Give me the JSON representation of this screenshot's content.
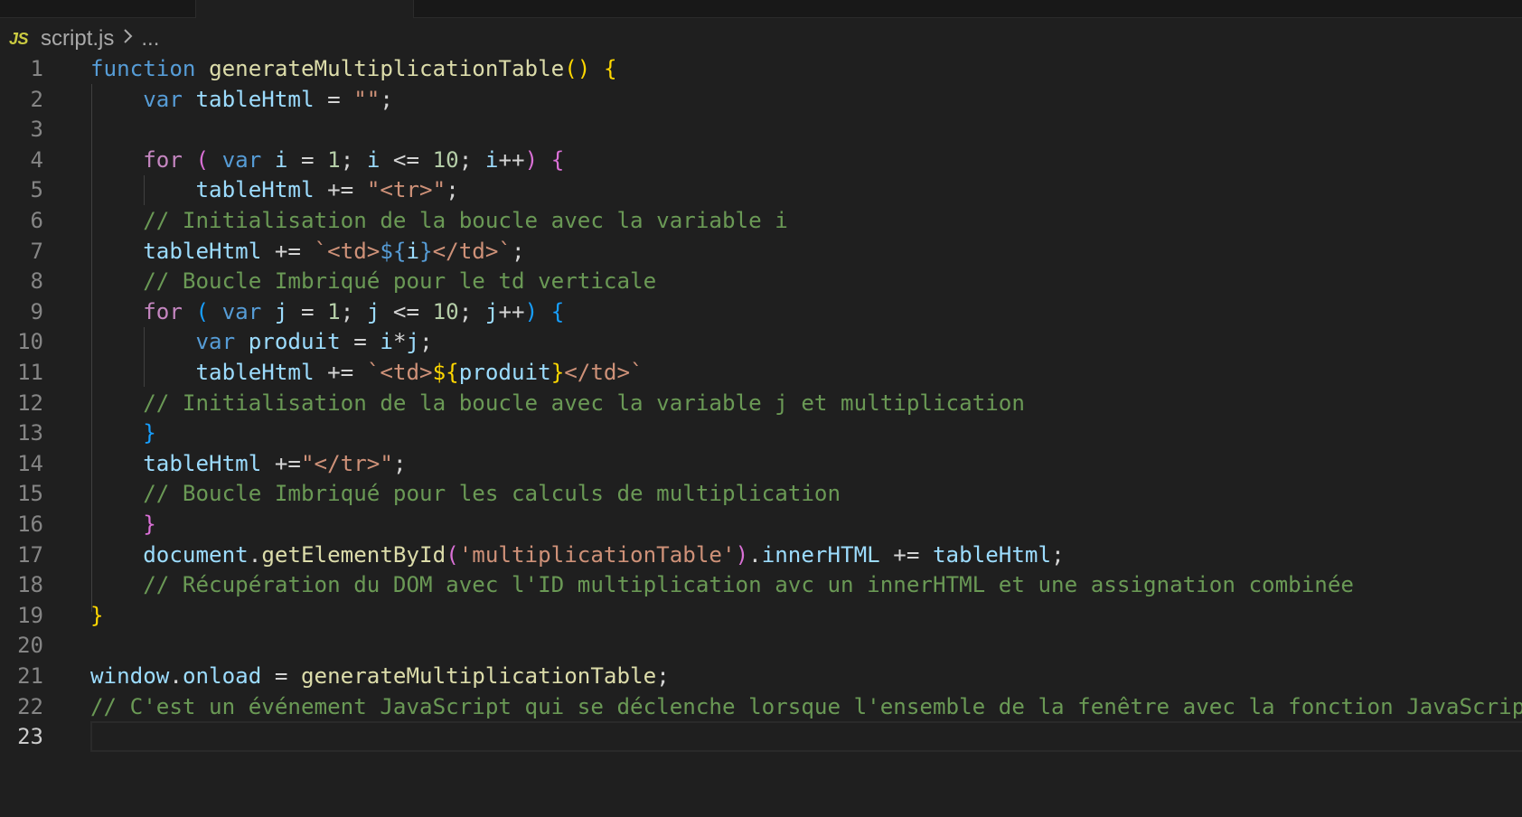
{
  "breadcrumb": {
    "file_icon": "JS",
    "file_name": "script.js",
    "separator_icon": "chevron-right-icon",
    "more": "..."
  },
  "editor": {
    "current_line": 23,
    "lines": [
      {
        "number": "1",
        "tokens": [
          [
            "kw",
            "function"
          ],
          [
            "plain",
            " "
          ],
          [
            "fn",
            "generateMultiplicationTable"
          ],
          [
            "brk1",
            "()"
          ],
          [
            "plain",
            " "
          ],
          [
            "brk1",
            "{"
          ]
        ]
      },
      {
        "number": "2",
        "tokens": [
          [
            "plain",
            "    "
          ],
          [
            "kw",
            "var"
          ],
          [
            "plain",
            " "
          ],
          [
            "var",
            "tableHtml"
          ],
          [
            "plain",
            " = "
          ],
          [
            "str",
            "\"\""
          ],
          [
            "plain",
            ";"
          ]
        ]
      },
      {
        "number": "3",
        "tokens": []
      },
      {
        "number": "4",
        "tokens": [
          [
            "plain",
            "    "
          ],
          [
            "ctl",
            "for"
          ],
          [
            "plain",
            " "
          ],
          [
            "brk2",
            "("
          ],
          [
            "plain",
            " "
          ],
          [
            "kw",
            "var"
          ],
          [
            "plain",
            " "
          ],
          [
            "var",
            "i"
          ],
          [
            "plain",
            " = "
          ],
          [
            "num",
            "1"
          ],
          [
            "plain",
            "; "
          ],
          [
            "var",
            "i"
          ],
          [
            "plain",
            " <= "
          ],
          [
            "num",
            "10"
          ],
          [
            "plain",
            "; "
          ],
          [
            "var",
            "i"
          ],
          [
            "plain",
            "++"
          ],
          [
            "brk2",
            ")"
          ],
          [
            "plain",
            " "
          ],
          [
            "brk2",
            "{"
          ]
        ]
      },
      {
        "number": "5",
        "tokens": [
          [
            "plain",
            "        "
          ],
          [
            "var",
            "tableHtml"
          ],
          [
            "plain",
            " += "
          ],
          [
            "str",
            "\"<tr>\""
          ],
          [
            "plain",
            ";"
          ]
        ]
      },
      {
        "number": "6",
        "tokens": [
          [
            "plain",
            "    "
          ],
          [
            "cmt",
            "// Initialisation de la boucle avec la variable i"
          ]
        ]
      },
      {
        "number": "7",
        "tokens": [
          [
            "plain",
            "    "
          ],
          [
            "var",
            "tableHtml"
          ],
          [
            "plain",
            " += "
          ],
          [
            "str",
            "`<td>"
          ],
          [
            "tplx",
            "${"
          ],
          [
            "var",
            "i"
          ],
          [
            "tplx",
            "}"
          ],
          [
            "str",
            "</td>`"
          ],
          [
            "plain",
            ";"
          ]
        ]
      },
      {
        "number": "8",
        "tokens": [
          [
            "plain",
            "    "
          ],
          [
            "cmt",
            "// Boucle Imbriqué pour le td verticale"
          ]
        ]
      },
      {
        "number": "9",
        "tokens": [
          [
            "plain",
            "    "
          ],
          [
            "ctl",
            "for"
          ],
          [
            "plain",
            " "
          ],
          [
            "brk3",
            "("
          ],
          [
            "plain",
            " "
          ],
          [
            "kw",
            "var"
          ],
          [
            "plain",
            " "
          ],
          [
            "var",
            "j"
          ],
          [
            "plain",
            " = "
          ],
          [
            "num",
            "1"
          ],
          [
            "plain",
            "; "
          ],
          [
            "var",
            "j"
          ],
          [
            "plain",
            " <= "
          ],
          [
            "num",
            "10"
          ],
          [
            "plain",
            "; "
          ],
          [
            "var",
            "j"
          ],
          [
            "plain",
            "++"
          ],
          [
            "brk3",
            ")"
          ],
          [
            "plain",
            " "
          ],
          [
            "brk3",
            "{"
          ]
        ]
      },
      {
        "number": "10",
        "tokens": [
          [
            "plain",
            "        "
          ],
          [
            "kw",
            "var"
          ],
          [
            "plain",
            " "
          ],
          [
            "var",
            "produit"
          ],
          [
            "plain",
            " = "
          ],
          [
            "var",
            "i"
          ],
          [
            "plain",
            "*"
          ],
          [
            "var",
            "j"
          ],
          [
            "plain",
            ";"
          ]
        ]
      },
      {
        "number": "11",
        "tokens": [
          [
            "plain",
            "        "
          ],
          [
            "var",
            "tableHtml"
          ],
          [
            "plain",
            " += "
          ],
          [
            "str",
            "`<td>"
          ],
          [
            "brk1",
            "${"
          ],
          [
            "var",
            "produit"
          ],
          [
            "brk1",
            "}"
          ],
          [
            "str",
            "</td>`"
          ]
        ]
      },
      {
        "number": "12",
        "tokens": [
          [
            "plain",
            "    "
          ],
          [
            "cmt",
            "// Initialisation de la boucle avec la variable j et multiplication"
          ]
        ]
      },
      {
        "number": "13",
        "tokens": [
          [
            "plain",
            "    "
          ],
          [
            "brk3",
            "}"
          ]
        ]
      },
      {
        "number": "14",
        "tokens": [
          [
            "plain",
            "    "
          ],
          [
            "var",
            "tableHtml"
          ],
          [
            "plain",
            " +="
          ],
          [
            "str",
            "\"</tr>\""
          ],
          [
            "plain",
            ";"
          ]
        ]
      },
      {
        "number": "15",
        "tokens": [
          [
            "plain",
            "    "
          ],
          [
            "cmt",
            "// Boucle Imbriqué pour les calculs de multiplication"
          ]
        ]
      },
      {
        "number": "16",
        "tokens": [
          [
            "plain",
            "    "
          ],
          [
            "brk2",
            "}"
          ]
        ]
      },
      {
        "number": "17",
        "tokens": [
          [
            "plain",
            "    "
          ],
          [
            "var",
            "document"
          ],
          [
            "plain",
            "."
          ],
          [
            "fn",
            "getElementById"
          ],
          [
            "brk2",
            "("
          ],
          [
            "str",
            "'multiplicationTable'"
          ],
          [
            "brk2",
            ")"
          ],
          [
            "plain",
            "."
          ],
          [
            "var",
            "innerHTML"
          ],
          [
            "plain",
            " += "
          ],
          [
            "var",
            "tableHtml"
          ],
          [
            "plain",
            ";"
          ]
        ]
      },
      {
        "number": "18",
        "tokens": [
          [
            "plain",
            "    "
          ],
          [
            "cmt",
            "// Récupération du DOM avec l'ID multiplication avc un innerHTML et une assignation combinée"
          ]
        ]
      },
      {
        "number": "19",
        "tokens": [
          [
            "brk1",
            "}"
          ]
        ]
      },
      {
        "number": "20",
        "tokens": []
      },
      {
        "number": "21",
        "tokens": [
          [
            "var",
            "window"
          ],
          [
            "plain",
            "."
          ],
          [
            "var",
            "onload"
          ],
          [
            "plain",
            " = "
          ],
          [
            "fn",
            "generateMultiplicationTable"
          ],
          [
            "plain",
            ";"
          ]
        ]
      },
      {
        "number": "22",
        "tokens": [
          [
            "cmt",
            "// C'est un événement JavaScript qui se déclenche lorsque l'ensemble de la fenêtre avec la fonction JavaScript"
          ]
        ]
      },
      {
        "number": "23",
        "tokens": []
      }
    ]
  }
}
